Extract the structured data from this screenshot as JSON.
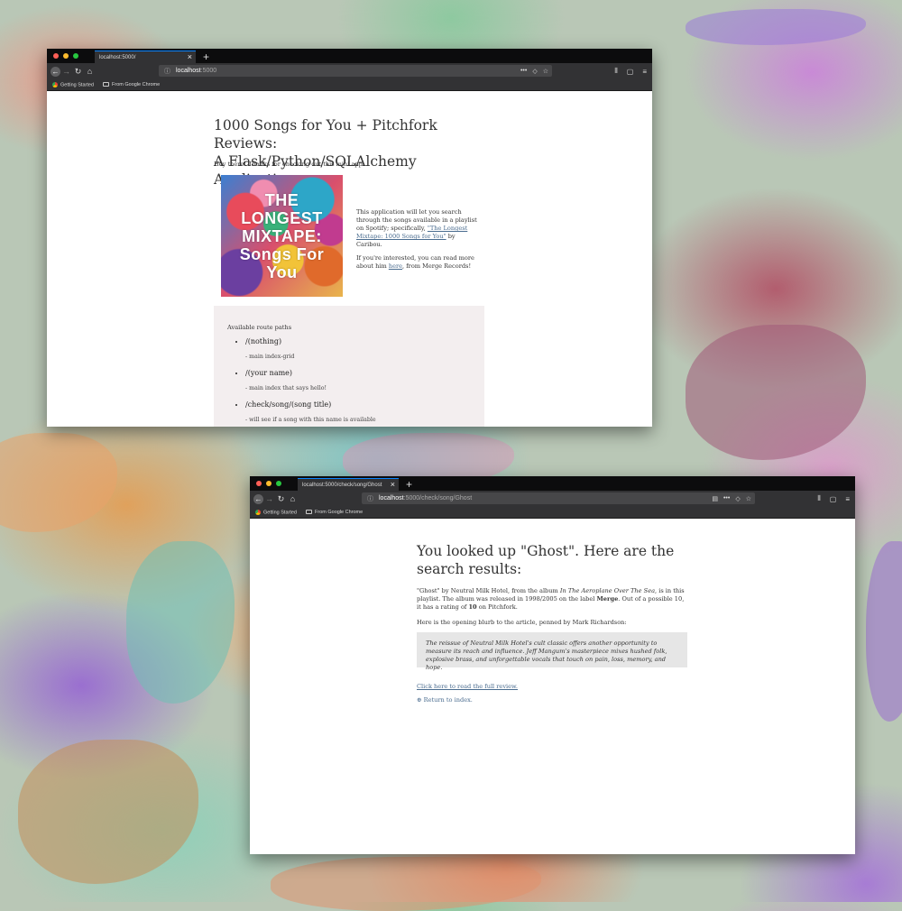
{
  "windows": [
    {
      "tab_title": "localhost:5000/",
      "url_host": "localhost",
      "url_path": ":5000",
      "bookmarks": [
        "Getting Started",
        "From Google Chrome"
      ],
      "page": {
        "title_line1": "1000 Songs for You + Pitchfork Reviews:",
        "title_line2": "A Flask/Python/SQLAlchemy Application",
        "greeting": "Hey there! Thanks for checking out this mini app.",
        "album_art_text": "THE LONGEST MIXTAPE: Songs For You",
        "desc_before_link": "This application will let you search through the songs available in a playlist on Spotify; specifically, ",
        "desc_link": "\"The Longest Mixtape: 1000 Songs for You\"",
        "desc_after_link": " by Caribou.",
        "more_before_link": "If you're interested, you can read more about him ",
        "more_link": "here",
        "more_after_link": ", from Merge Records!",
        "routes_heading": "Available route paths",
        "routes": [
          {
            "path": "/(nothing)",
            "desc": "- main index-grid"
          },
          {
            "path": "/(your name)",
            "desc": "- main index that says hello!"
          },
          {
            "path": "/check/song/(song title)",
            "desc": "- will see if a song with this name is available"
          }
        ]
      }
    },
    {
      "tab_title": "localhost:5000/check/song/Ghost",
      "url_host": "localhost",
      "url_path": ":5000/check/song/Ghost",
      "bookmarks": [
        "Getting Started",
        "From Google Chrome"
      ],
      "page": {
        "title_line1": "You looked up \"Ghost\". Here are the",
        "title_line2": "search results:",
        "result_p1": "\"Ghost\" by Neutral Milk Hotel, from the album ",
        "result_album": "In The Aeroplane Over The Sea",
        "result_p2": ", is in this playlist. The album was released in 1998/2005 on the label ",
        "result_label": "Merge",
        "result_p3": ". Out of a possible 10, it has a rating of ",
        "result_rating": "10",
        "result_p4": " on Pitchfork.",
        "blurb_intro": "Here is the opening blurb to the article, penned by Mark Richardson:",
        "blurb": "The reissue of Neutral Milk Hotel's cult classic offers another opportunity to measure its reach and influence. Jeff Mangum's masterpiece mixes hushed folk, explosive brass, and unforgettable vocals that touch on pain, loss, memory, and hope.",
        "full_review_link": "Click here to read the full review.",
        "return_link": "Return to index."
      }
    }
  ],
  "colors": {
    "link": "#4a6c8f",
    "titlebar": "#0c0c0d",
    "toolbar": "#323234",
    "routes_bg": "#f3eeef",
    "blurb_bg": "#e6e6e6"
  }
}
